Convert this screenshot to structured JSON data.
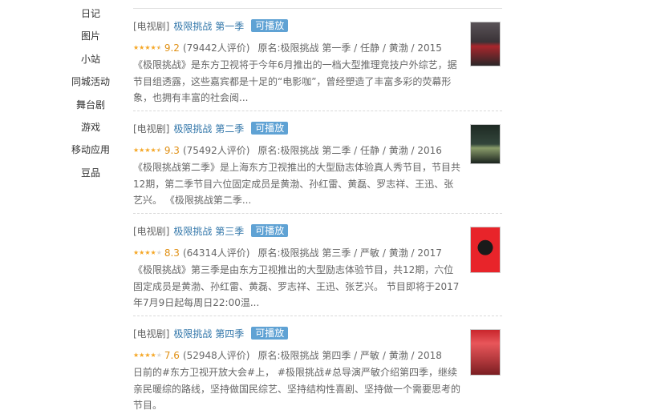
{
  "sidebar": {
    "items": [
      {
        "label": "日记"
      },
      {
        "label": "图片"
      },
      {
        "label": "小站"
      },
      {
        "label": "同城活动"
      },
      {
        "label": "舞台剧"
      },
      {
        "label": "游戏"
      },
      {
        "label": "移动应用"
      },
      {
        "label": "豆品"
      }
    ]
  },
  "results": [
    {
      "type": "[电视剧]",
      "title": "极限挑战 第一季",
      "badge": "可播放",
      "stars": 4.5,
      "score": "9.2",
      "count": "(79442人评价)",
      "meta": "原名:极限挑战 第一季 / 任静 / 黄渤 / 2015",
      "desc": "《极限挑战》是东方卫视将于今年6月推出的一档大型推理竞技户外综艺，据节目组透露，这些嘉宾都是十足的“电影咖”，曾经塑造了丰富多彩的荧幕形象，也拥有丰富的社会阅..."
    },
    {
      "type": "[电视剧]",
      "title": "极限挑战 第二季",
      "badge": "可播放",
      "stars": 4.5,
      "score": "9.3",
      "count": "(75492人评价)",
      "meta": "原名:极限挑战 第二季 / 任静 / 黄渤 / 2016",
      "desc": "《极限挑战第二季》是上海东方卫视推出的大型励志体验真人秀节目，节目共12期，第二季节目六位固定成员是黄渤、孙红雷、黄磊、罗志祥、王迅、张艺兴。 《极限挑战第二季..."
    },
    {
      "type": "[电视剧]",
      "title": "极限挑战 第三季",
      "badge": "可播放",
      "stars": 4,
      "score": "8.3",
      "count": "(64314人评价)",
      "meta": "原名:极限挑战 第三季 / 严敏 / 黄渤 / 2017",
      "desc": "《极限挑战》第三季是由东方卫视推出的大型励志体验节目，共12期，六位固定成员是黄渤、孙红雷、黄磊、罗志祥、王迅、张艺兴。 节目即将于2017年7月9日起每周日22:00温..."
    },
    {
      "type": "[电视剧]",
      "title": "极限挑战 第四季",
      "badge": "可播放",
      "stars": 4,
      "score": "7.6",
      "count": "(52948人评价)",
      "meta": "原名:极限挑战 第四季 / 严敏 / 黄渤 / 2018",
      "desc": "日前的#东方卫视开放大会#上， #极限挑战#总导演严敏介绍第四季，继续亲民暖综的路线，坚持做国民综艺、坚持结构性喜剧、坚持做一个需要思考的节目。"
    }
  ],
  "colors": {
    "link": "#3377aa",
    "badge": "#5fa2d4",
    "score": "#e09015",
    "star": "#f5a623"
  }
}
